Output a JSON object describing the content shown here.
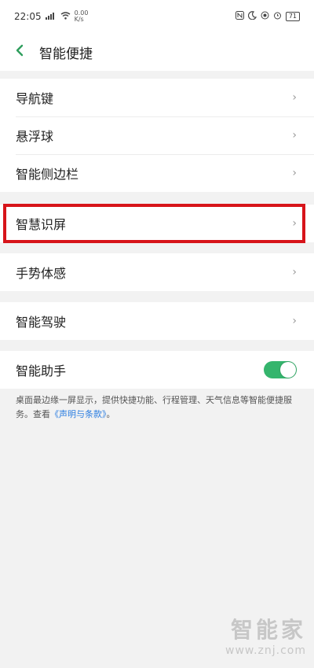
{
  "status_bar": {
    "time": "22:05",
    "net_speed": "0.00\nK/s",
    "battery": "71",
    "icons": [
      "signal-icon",
      "wifi-icon",
      "nfc-icon",
      "moon-icon",
      "location-icon",
      "alarm-icon",
      "battery-icon"
    ]
  },
  "header": {
    "back_icon": "chevron-left-icon",
    "title": "智能便捷"
  },
  "groups": [
    {
      "items": [
        "导航键",
        "悬浮球",
        "智能侧边栏"
      ]
    },
    {
      "items": [
        "智慧识屏"
      ]
    },
    {
      "items": [
        "手势体感"
      ]
    },
    {
      "items": [
        "智能驾驶"
      ]
    },
    {
      "items": [
        "智能助手"
      ]
    }
  ],
  "assistant_toggle": {
    "on": true,
    "color": "#35b56d"
  },
  "description": {
    "text": "桌面最边缘一屏显示，提供快捷功能、行程管理、天气信息等智能便捷服务。查看",
    "link": "《声明与条款》",
    "tail": "。"
  },
  "highlight": {
    "color": "#d7141a",
    "target": "智慧识屏"
  },
  "watermark": {
    "logo": "智能家",
    "url": "www.znj.com"
  }
}
